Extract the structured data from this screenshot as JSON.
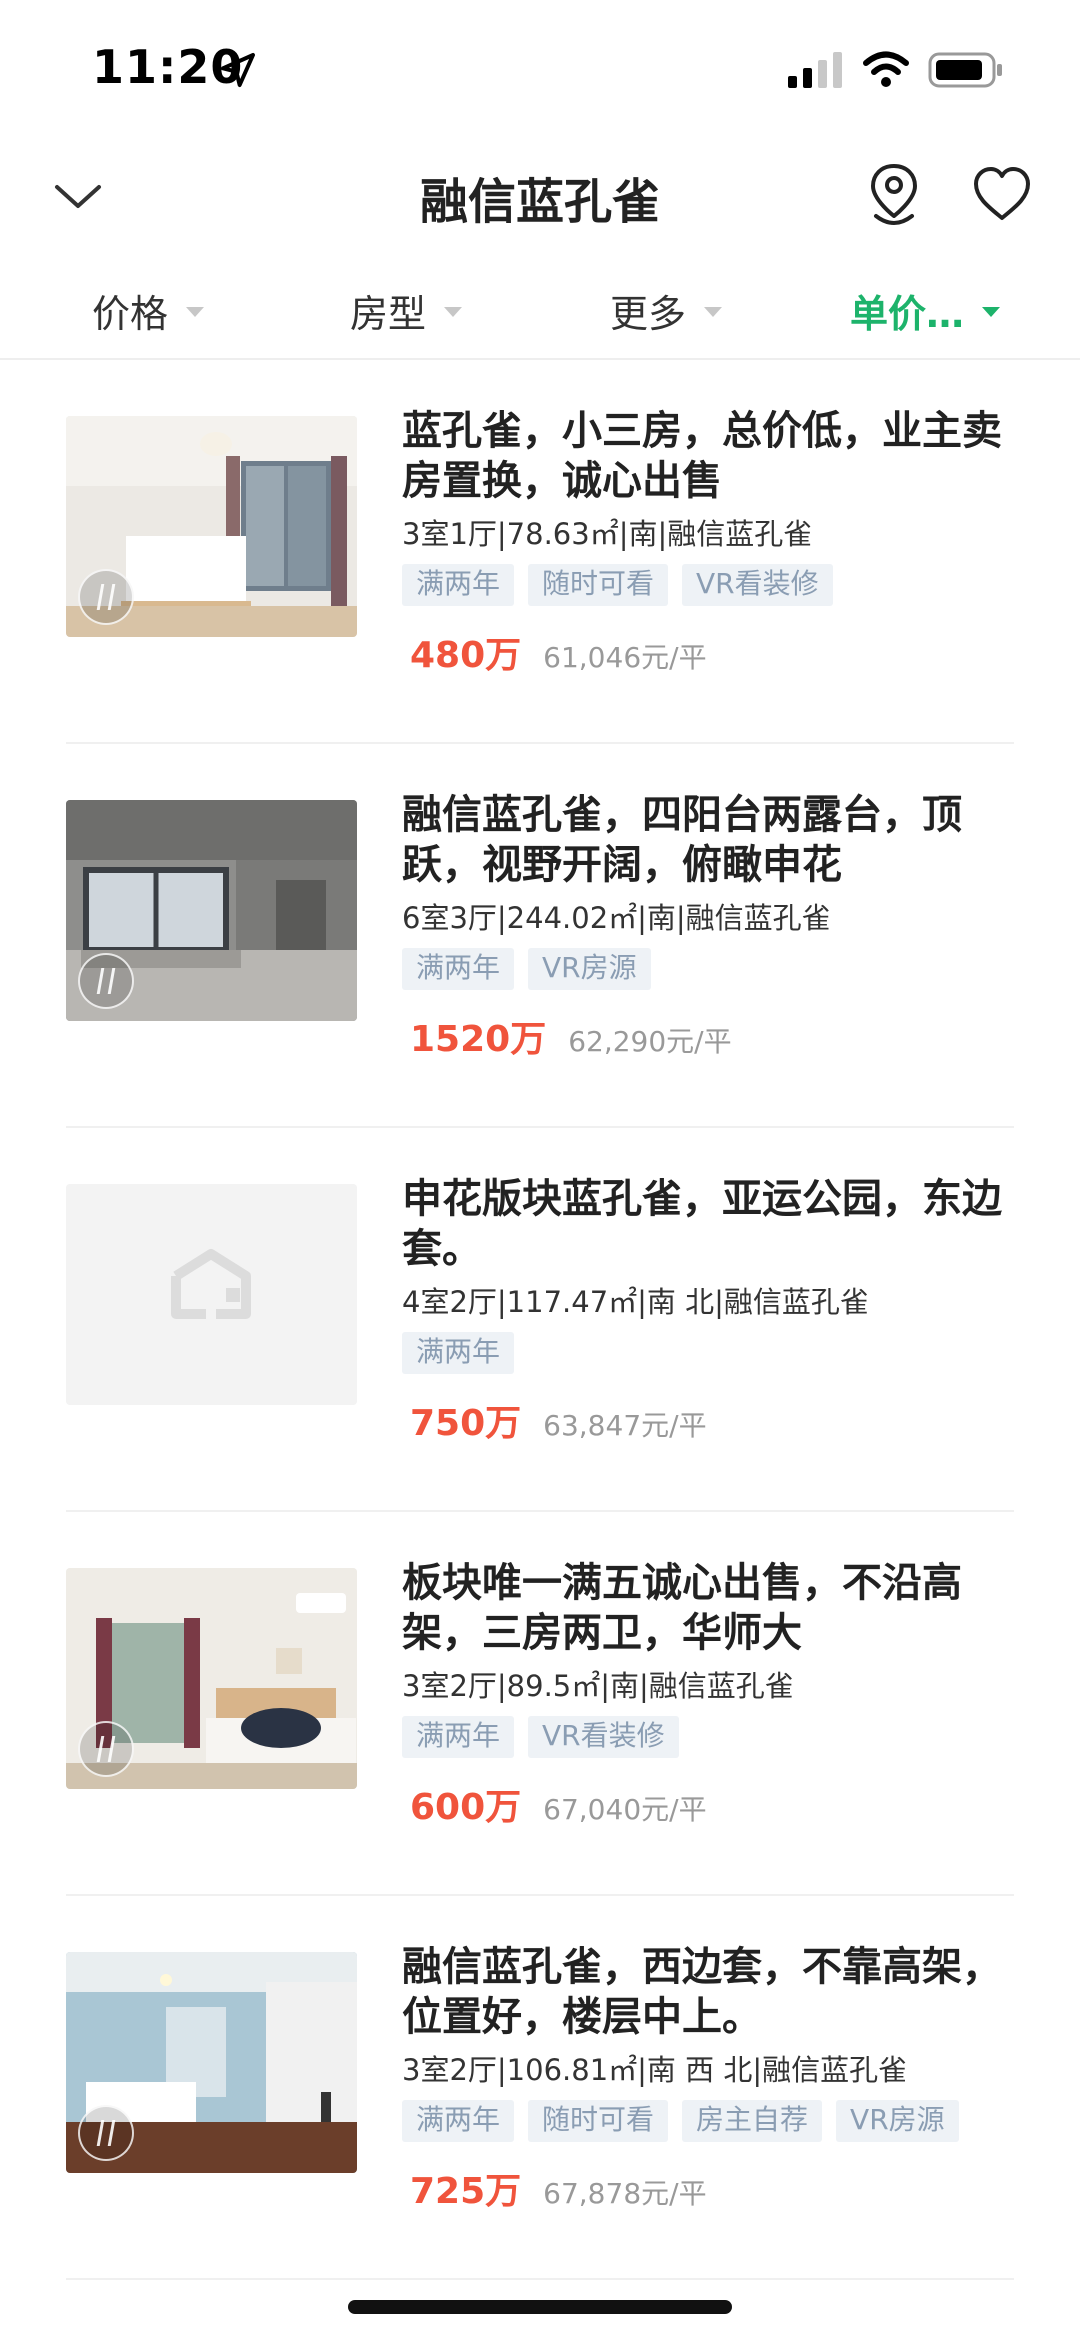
{
  "status_bar": {
    "time": "11:20"
  },
  "nav": {
    "title": "融信蓝孔雀"
  },
  "filters": [
    {
      "label": "价格",
      "active": false
    },
    {
      "label": "房型",
      "active": false
    },
    {
      "label": "更多",
      "active": false
    },
    {
      "label": "单价…",
      "active": true
    }
  ],
  "colors": {
    "accent_green": "#1db36b",
    "price_red": "#f0543c",
    "tag_text": "#8a9db3"
  },
  "listings": [
    {
      "title": "蓝孔雀，小三房，总价低，业主卖房置换，诚心出售",
      "meta": "3室1厅|78.63㎡|南|融信蓝孔雀",
      "tags": [
        "满两年",
        "随时可看",
        "VR看装修"
      ],
      "price": "480万",
      "unit_price": "61,046元/平",
      "image": "bedroom-photo"
    },
    {
      "title": "融信蓝孔雀，四阳台两露台，顶跃，视野开阔，俯瞰申花",
      "meta": "6室3厅|244.02㎡|南|融信蓝孔雀",
      "tags": [
        "满两年",
        "VR房源"
      ],
      "price": "1520万",
      "unit_price": "62,290元/平",
      "image": "unfinished-room-photo"
    },
    {
      "title": "申花版块蓝孔雀，亚运公园，东边套。",
      "meta": "4室2厅|117.47㎡|南 北|融信蓝孔雀",
      "tags": [
        "满两年"
      ],
      "price": "750万",
      "unit_price": "63,847元/平",
      "image": "placeholder-house-icon"
    },
    {
      "title": "板块唯一满五诚心出售，不沿高架，三房两卫，华师大",
      "meta": "3室2厅|89.5㎡|南|融信蓝孔雀",
      "tags": [
        "满两年",
        "VR看装修"
      ],
      "price": "600万",
      "unit_price": "67,040元/平",
      "image": "bedroom-photo"
    },
    {
      "title": "融信蓝孔雀，西边套，不靠高架，位置好，楼层中上。",
      "meta": "3室2厅|106.81㎡|南 西 北|融信蓝孔雀",
      "tags": [
        "满两年",
        "随时可看",
        "房主自荐",
        "VR房源"
      ],
      "price": "725万",
      "unit_price": "67,878元/平",
      "image": "bedroom-photo"
    }
  ]
}
